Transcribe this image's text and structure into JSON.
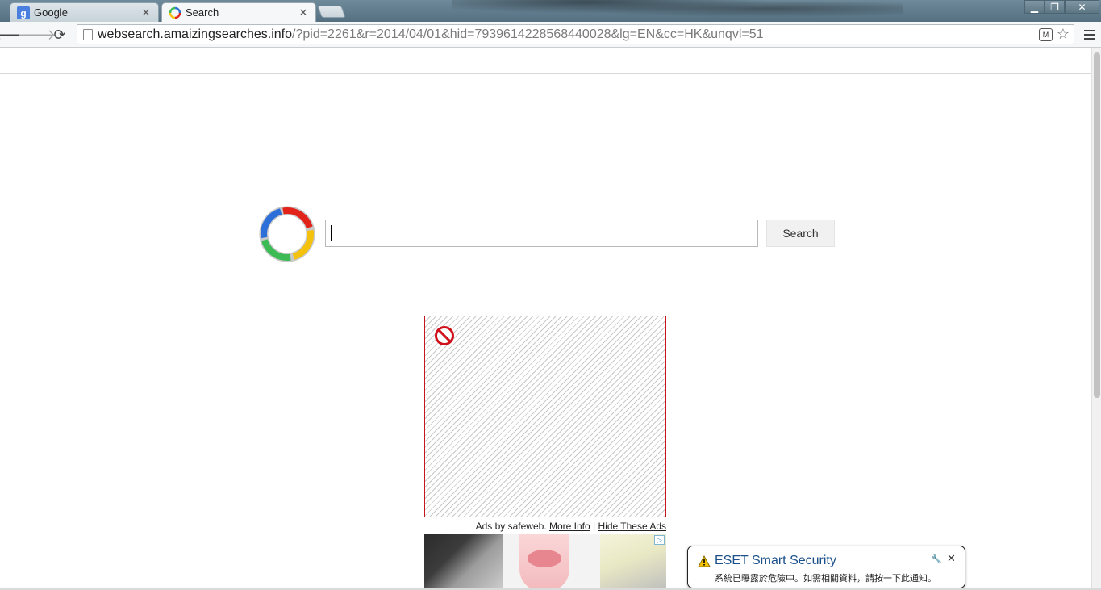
{
  "browser": {
    "tabs": [
      {
        "title": "Google",
        "favicon": "google-g-icon",
        "active": false
      },
      {
        "title": "Search",
        "favicon": "ring-logo-icon",
        "active": true
      }
    ],
    "url": {
      "host": "websearch.amaizingsearches.info",
      "path": "/?pid=2261&r=2014/04/01&hid=7939614228568440028&lg=EN&cc=HK&unqvl=51"
    },
    "icons": {
      "back": "back-arrow-icon",
      "forward": "forward-arrow-icon",
      "reload": "reload-icon",
      "star": "bookmark-star-icon",
      "menu": "hamburger-menu-icon"
    }
  },
  "search": {
    "input_value": "",
    "button_label": "Search"
  },
  "ad": {
    "caption_prefix": "Ads by safeweb.",
    "more_info": "More Info",
    "separator": "|",
    "hide": "Hide These Ads",
    "block_icon": "blocked-circle-icon",
    "border_color": "#c4161c"
  },
  "notification": {
    "title": "ESET Smart Security",
    "message": "系統已曝露於危險中。如需相關資料，請按一下此通知。",
    "icon": "warning-triangle-icon"
  },
  "colors": {
    "logo_red": "#e2231a",
    "logo_yellow": "#f4c20d",
    "logo_green": "#3cba54",
    "logo_blue": "#2d6fd8",
    "notification_title": "#1a4f8a"
  }
}
